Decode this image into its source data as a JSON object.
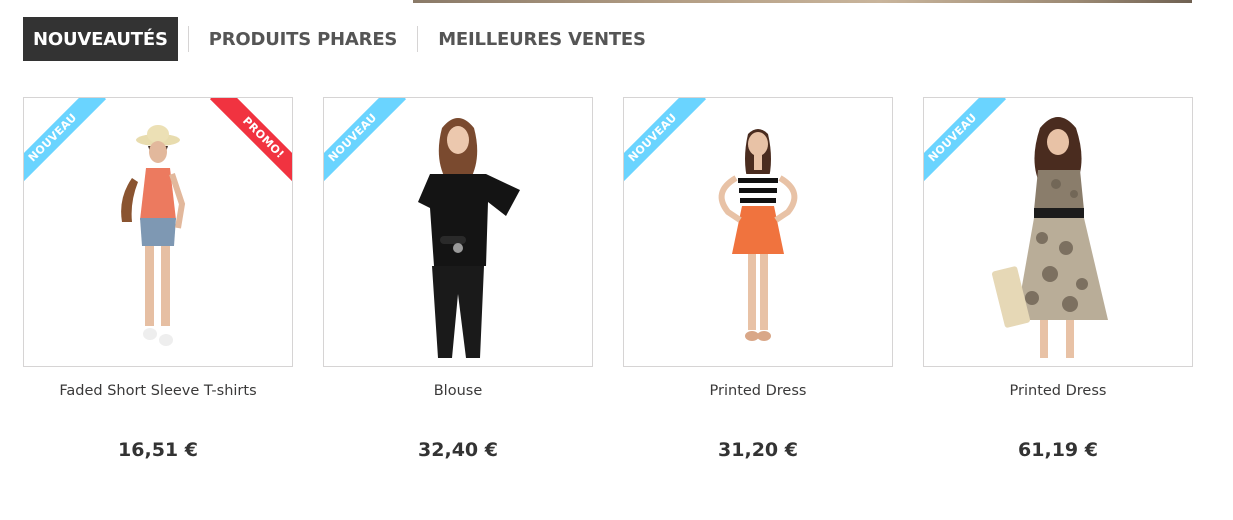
{
  "tabs": [
    {
      "label": "NOUVEAUTÉS",
      "active": true
    },
    {
      "label": "PRODUITS PHARES",
      "active": false
    },
    {
      "label": "MEILLEURES VENTES",
      "active": false
    }
  ],
  "badges": {
    "new": "NOUVEAU",
    "sale": "PROMO!"
  },
  "colors": {
    "new_ribbon": "#6ad4ff",
    "sale_ribbon": "#f13340",
    "active_tab": "#333333"
  },
  "products": [
    {
      "name": "Faded Short Sleeve T-shirts",
      "price": "16,51 €",
      "badges": [
        "new",
        "sale"
      ]
    },
    {
      "name": "Blouse",
      "price": "32,40 €",
      "badges": [
        "new"
      ]
    },
    {
      "name": "Printed Dress",
      "price": "31,20 €",
      "badges": [
        "new"
      ]
    },
    {
      "name": "Printed Dress",
      "price": "61,19 €",
      "badges": [
        "new"
      ]
    }
  ]
}
